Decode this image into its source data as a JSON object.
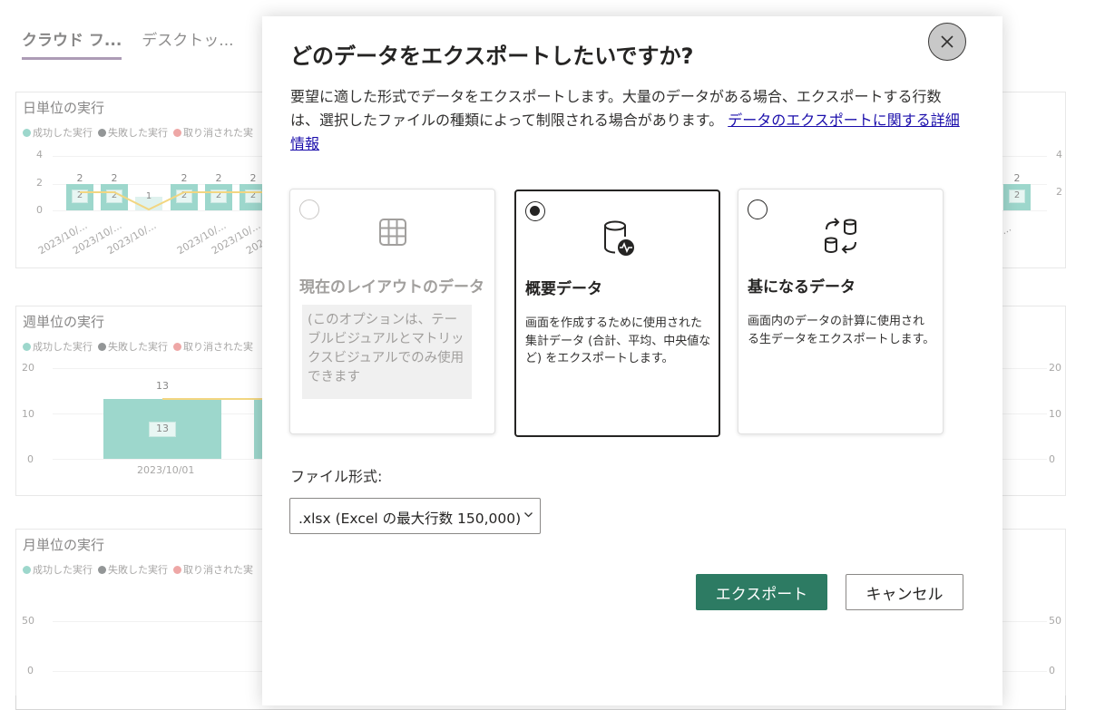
{
  "tabs": [
    {
      "label": "クラウド フ..."
    },
    {
      "label": "デスクトッ..."
    }
  ],
  "charts": {
    "legend": {
      "success": "成功した実行",
      "failed": "失敗した実行",
      "cancelled": "取り消された実",
      "success_color": "#4db6a2",
      "failed_color": "#3b4142",
      "cancelled_color": "#e0605e"
    },
    "daily": {
      "title": "日単位の実行",
      "y_ticks": [
        "4",
        "2",
        "0"
      ],
      "right_ticks": [
        "4",
        "2"
      ],
      "bar_values": [
        "2",
        "2",
        "1",
        "2",
        "2",
        "2"
      ],
      "right_bar_value": "2",
      "x_labels": [
        "2023/10/...",
        "2023/10/...",
        "2023/10/...",
        "2023/10/...",
        "2023/10/...",
        "2023"
      ],
      "right_x_label": "/..."
    },
    "weekly": {
      "title": "週単位の実行",
      "y_ticks": [
        "20",
        "10",
        "0"
      ],
      "right_ticks": [
        "20",
        "10",
        "0"
      ],
      "bar_value": "13",
      "x_label": "2023/10/01"
    },
    "monthly": {
      "title": "月単位の実行",
      "y_ticks": [
        "50",
        "0"
      ],
      "right_ticks": [
        "50",
        "0"
      ]
    }
  },
  "dialog": {
    "title": "どのデータをエクスポートしたいですか?",
    "description": "要望に適した形式でデータをエクスポートします。大量のデータがある場合、エクスポートする行数は、選択したファイルの種類によって制限される場合があります。 ",
    "learn_more_link": "データのエクスポートに関する詳細情報",
    "options": [
      {
        "title": "現在のレイアウトのデータ",
        "note": "(このオプションは、テーブルビジュアルとマトリックスビジュアルでのみ使用できます",
        "icon": "table-grid-icon",
        "selected": false,
        "disabled": true
      },
      {
        "title": "概要データ",
        "description": "画面を作成するために使用された集計データ (合計、平均、中央値など) をエクスポートします。",
        "icon": "database-pulse-icon",
        "selected": true,
        "disabled": false
      },
      {
        "title": "基になるデータ",
        "description": "画面内のデータの計算に使用される生データをエクスポートします。",
        "icon": "database-transfer-icon",
        "selected": false,
        "disabled": false
      }
    ],
    "file_format_label": "ファイル形式:",
    "file_format_value": ".xlsx (Excel の最大行数 150,000)",
    "export_button": "エクスポート",
    "cancel_button": "キャンセル",
    "accent_color": "#2d7b63"
  }
}
